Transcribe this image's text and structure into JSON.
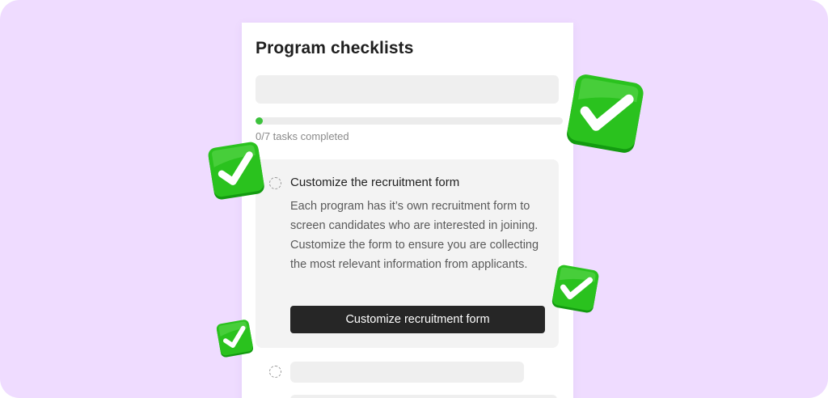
{
  "checklist": {
    "title": "Program checklists",
    "progress": {
      "completed": 0,
      "total": 7,
      "fraction": 0,
      "label": "0/7 tasks completed"
    },
    "active_task": {
      "title": "Customize the recruitment form",
      "description": "Each program has it’s own recruitment form to screen candidates who are interested in joining. Customize the form to ensure you are collecting the most relevant information from applicants.",
      "button_label": "Customize recruitment form"
    }
  },
  "colors": {
    "background": "#efdcff",
    "accent_green": "#3cc23c",
    "button_dark": "#262626",
    "check_sticker_green": "#2ac21e"
  },
  "decorations": {
    "stickers": [
      "check-mark-icon",
      "check-mark-icon",
      "check-mark-icon",
      "check-mark-icon"
    ]
  }
}
